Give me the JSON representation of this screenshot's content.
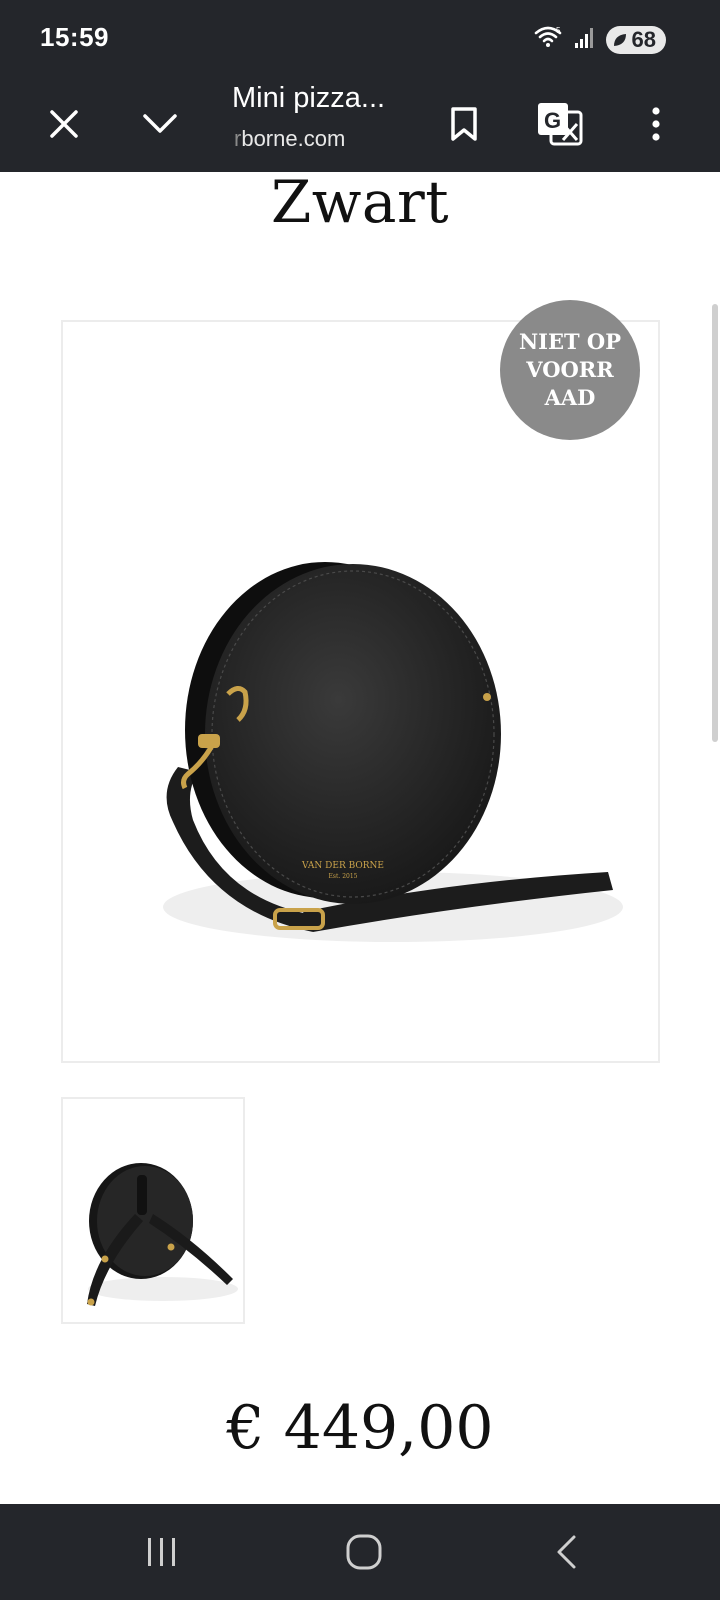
{
  "status_bar": {
    "time": "15:59",
    "battery": "68",
    "icons": [
      "wifi-icon",
      "signal-icon",
      "battery-icon"
    ]
  },
  "browser": {
    "title": "Mini pizza...",
    "domain_faded": "r",
    "domain": "borne.com",
    "icons": [
      "close-icon",
      "chevron-down-icon",
      "bookmark-icon",
      "translate-icon",
      "more-vert-icon"
    ]
  },
  "product": {
    "color_heading": "Zwart",
    "badge_lines": [
      "NIET OP",
      "VOORR",
      "AAD"
    ],
    "brand_stamp_line1": "VAN DER BORNE",
    "brand_stamp_line2": "Est. 2015",
    "price": "€ 449,00"
  },
  "nav_bar": {
    "icons": [
      "recent-apps-icon",
      "home-icon",
      "back-icon"
    ]
  }
}
